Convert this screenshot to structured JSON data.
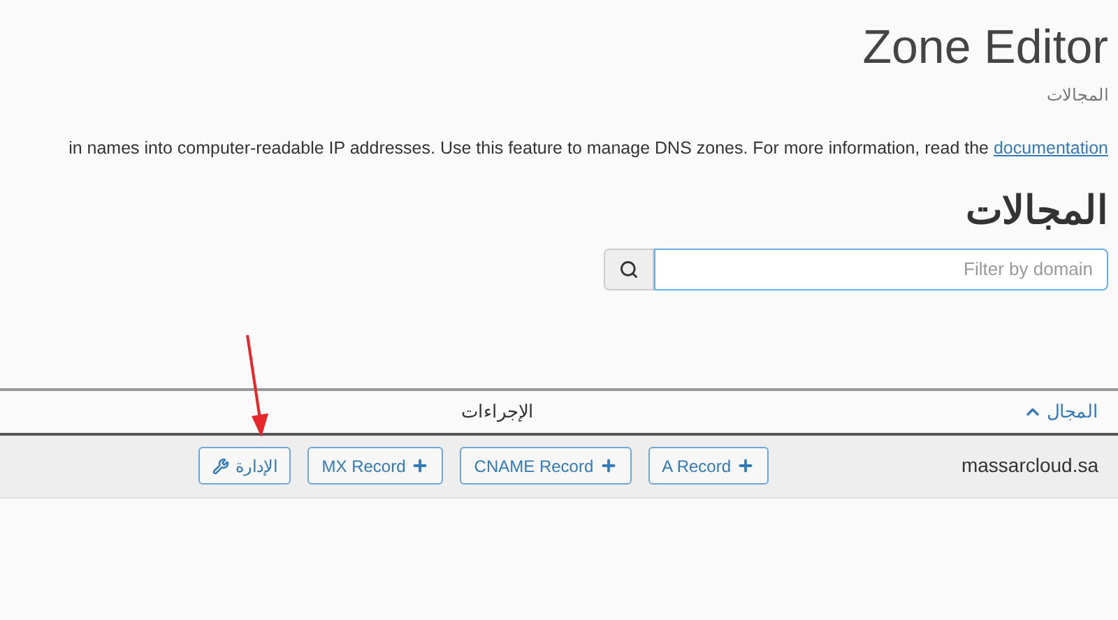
{
  "header": {
    "title": "Zone Editor",
    "subtitle": "المجالات"
  },
  "description": {
    "text": "in names into computer-readable IP addresses. Use this feature to manage DNS zones. For more information, read the",
    "link": "documentation"
  },
  "section_title": "المجالات",
  "search": {
    "placeholder": "Filter by domain"
  },
  "table": {
    "columns": [
      {
        "label": "المجال",
        "sorted": true
      },
      {
        "label": "الإجراءات",
        "sorted": false
      }
    ],
    "rows": [
      {
        "domain": "massarcloud.sa",
        "actions": [
          {
            "label": "A Record",
            "kind": "add"
          },
          {
            "label": "CNAME Record",
            "kind": "add"
          },
          {
            "label": "MX Record",
            "kind": "add"
          },
          {
            "label": "الإدارة",
            "kind": "manage"
          }
        ]
      }
    ]
  }
}
